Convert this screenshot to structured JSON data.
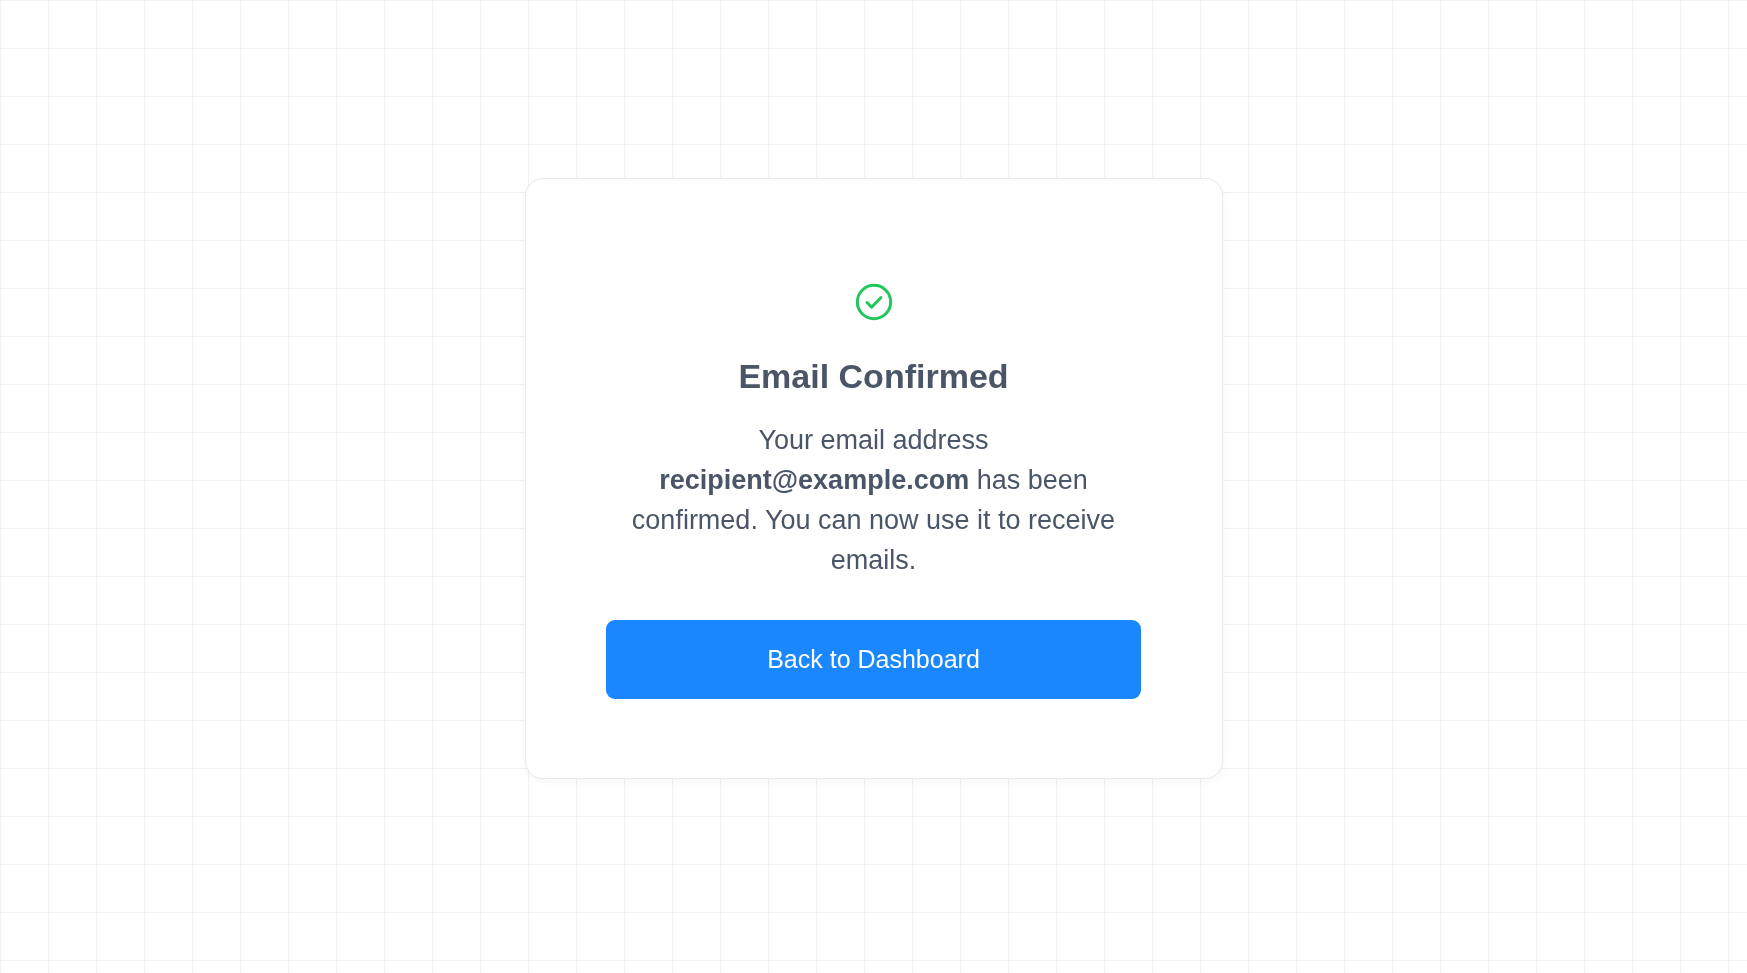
{
  "card": {
    "title": "Email Confirmed",
    "message": "Your email address **recipient@example.com** has been confirmed. You can now use it to receive emails.",
    "button": "Back to Dashboard"
  }
}
